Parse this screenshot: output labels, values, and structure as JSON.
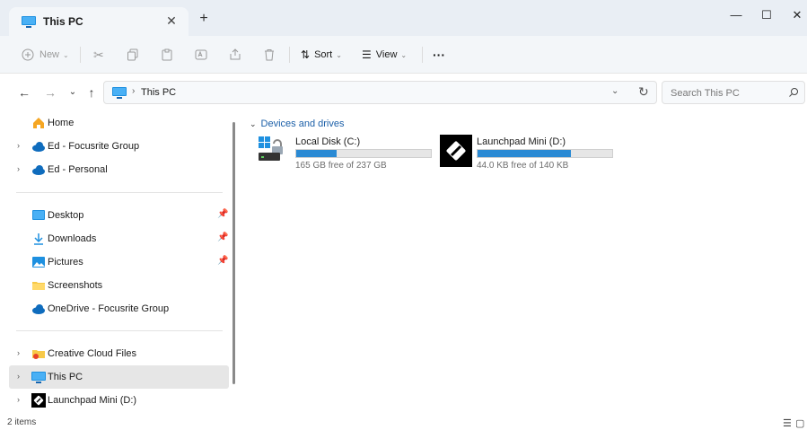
{
  "window": {
    "tab_title": "This PC",
    "tab_close": "✕",
    "new_tab": "+",
    "minimize": "—",
    "maximize": "☐",
    "close": "✕"
  },
  "toolbar": {
    "new_label": "New",
    "sort_label": "Sort",
    "view_label": "View",
    "more_label": "···"
  },
  "address": {
    "path": "This PC",
    "search_placeholder": "Search This PC"
  },
  "sidebar": {
    "items": [
      {
        "label": "Home",
        "icon": "home-icon"
      },
      {
        "label": "Ed - Focusrite Group",
        "icon": "cloud-icon"
      },
      {
        "label": "Ed - Personal",
        "icon": "cloud-icon"
      },
      {
        "label": "Desktop",
        "icon": "desktop-icon"
      },
      {
        "label": "Downloads",
        "icon": "download-icon"
      },
      {
        "label": "Pictures",
        "icon": "pictures-icon"
      },
      {
        "label": "Screenshots",
        "icon": "folder-icon"
      },
      {
        "label": "OneDrive - Focusrite Group",
        "icon": "cloud-icon"
      },
      {
        "label": "Creative Cloud Files",
        "icon": "creative-cloud-icon"
      },
      {
        "label": "This PC",
        "icon": "pc-icon"
      },
      {
        "label": "Launchpad Mini (D:)",
        "icon": "launchpad-icon"
      }
    ]
  },
  "content": {
    "group_label": "Devices and drives",
    "drives": [
      {
        "name": "Local Disk (C:)",
        "free_text": "165 GB free of 237 GB",
        "used_fraction": 0.3
      },
      {
        "name": "Launchpad Mini (D:)",
        "free_text": "44.0 KB free of 140 KB",
        "used_fraction": 0.69
      }
    ]
  },
  "status": {
    "item_count": "2 items"
  },
  "colors": {
    "accent": "#2a8ad4",
    "link": "#1b5fa8",
    "title_bg": "#e9eef4",
    "selected": "#e6e6e6"
  }
}
